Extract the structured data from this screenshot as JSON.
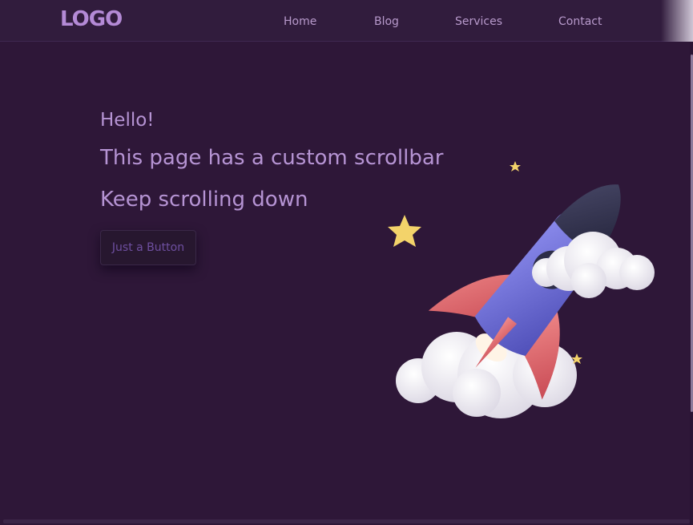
{
  "header": {
    "logo": "LOGO",
    "nav": [
      {
        "label": "Home"
      },
      {
        "label": "Blog"
      },
      {
        "label": "Services"
      },
      {
        "label": "Contact"
      }
    ]
  },
  "hero": {
    "greeting": "Hello!",
    "line1": "This page has a custom scrollbar",
    "line2": "Keep scrolling down",
    "button_label": "Just a Button"
  },
  "colors": {
    "background": "#2e1738",
    "accent_text": "#b694d4",
    "logo": "#b48ad6"
  },
  "illustration": {
    "icon": "rocket-icon"
  }
}
